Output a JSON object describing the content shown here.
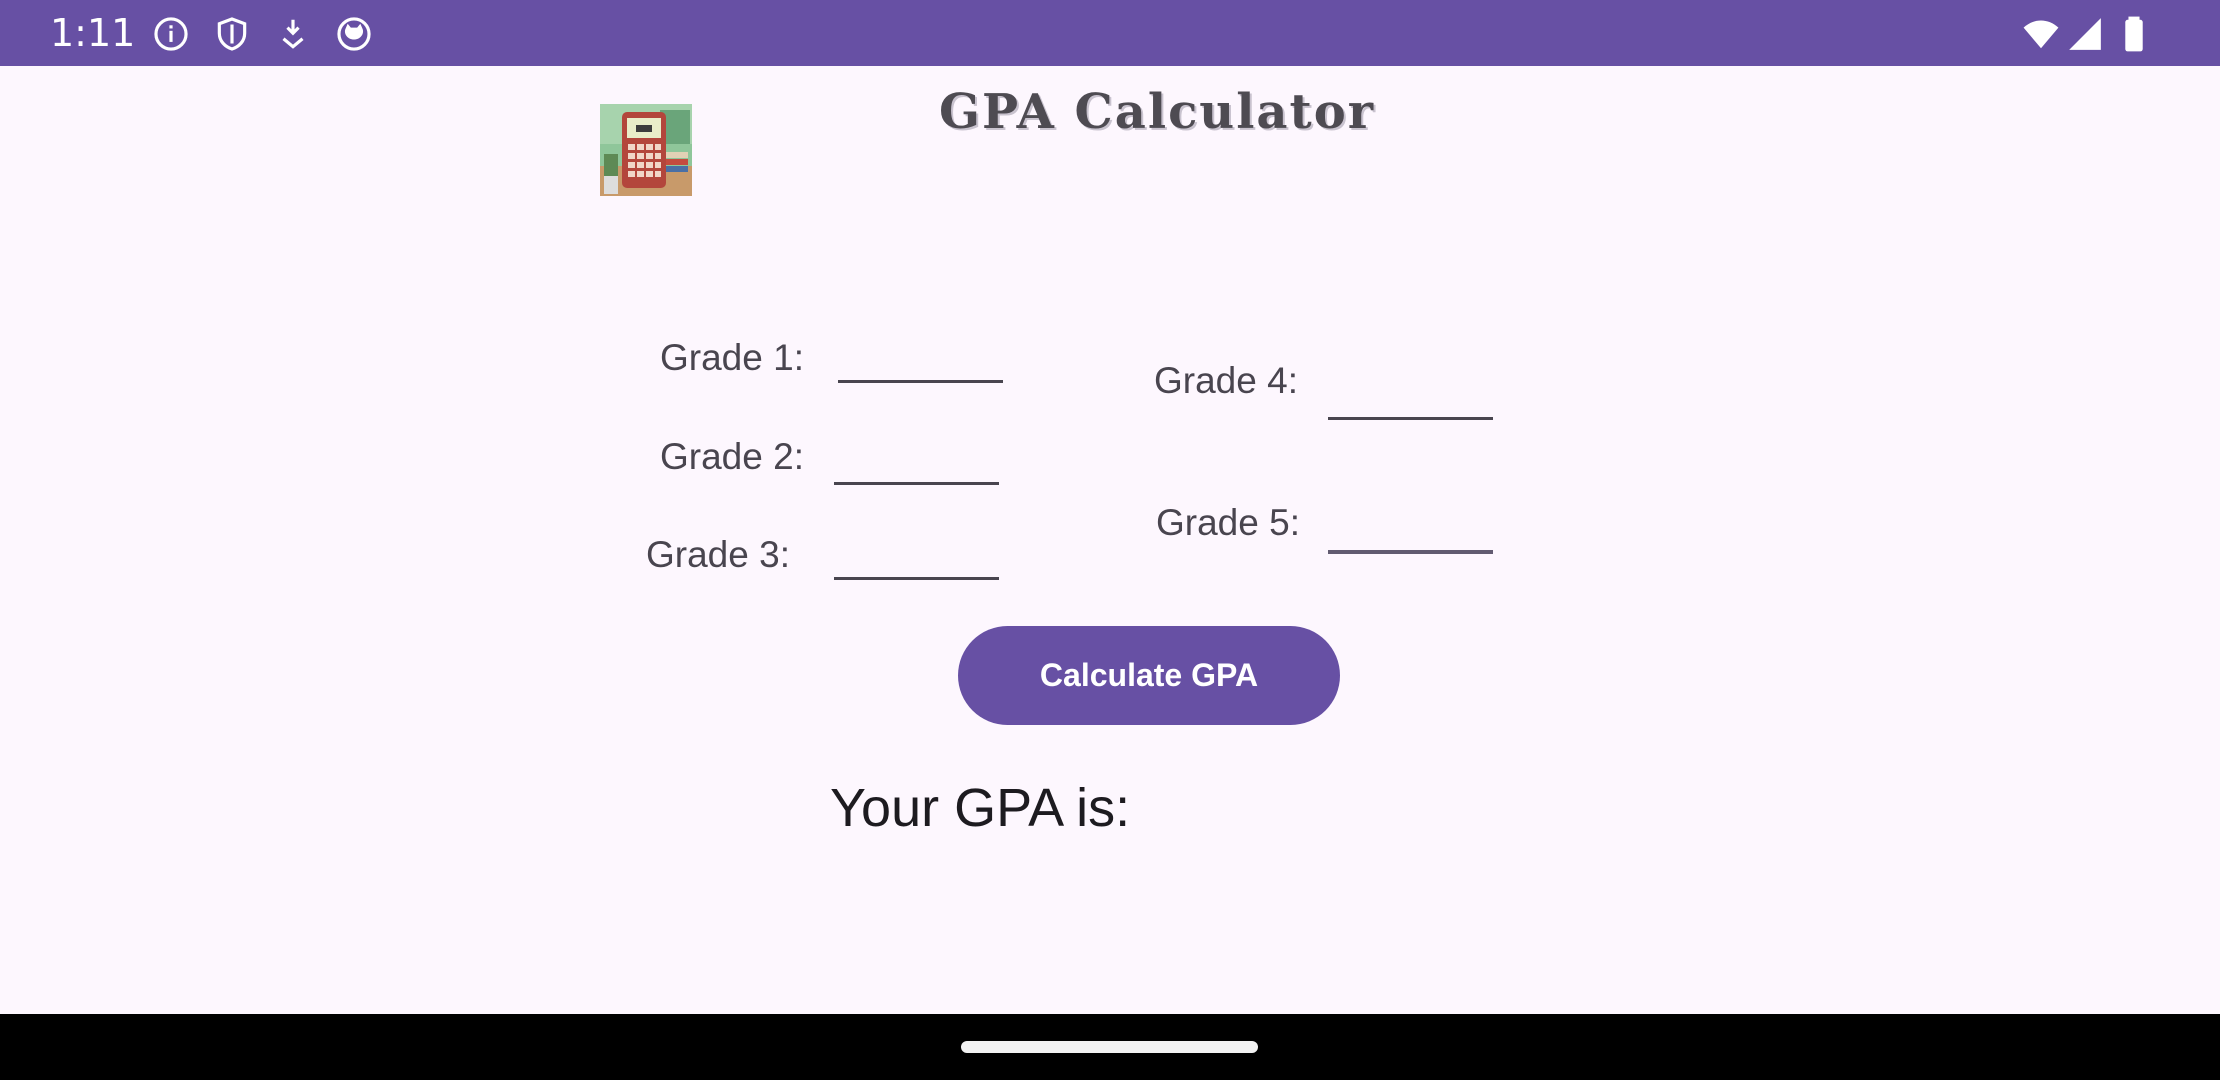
{
  "status_bar": {
    "time": "1:11",
    "left_icons": [
      "info-icon",
      "shield-icon",
      "download-icon",
      "cat-icon"
    ],
    "right_icons": [
      "wifi-icon",
      "cell-signal-icon",
      "battery-icon"
    ],
    "background": "#6750a4"
  },
  "header": {
    "title": "GPA Calculator",
    "logo": "calculator-logo"
  },
  "grades": [
    {
      "label": "Grade 1:",
      "value": ""
    },
    {
      "label": "Grade 2:",
      "value": ""
    },
    {
      "label": "Grade 3:",
      "value": ""
    },
    {
      "label": "Grade 4:",
      "value": ""
    },
    {
      "label": "Grade 5:",
      "value": ""
    }
  ],
  "actions": {
    "calculate_label": "Calculate GPA"
  },
  "result": {
    "label": "Your GPA is:"
  },
  "colors": {
    "primary": "#6750a4",
    "background": "#fdf7fe",
    "text": "#49454f"
  }
}
